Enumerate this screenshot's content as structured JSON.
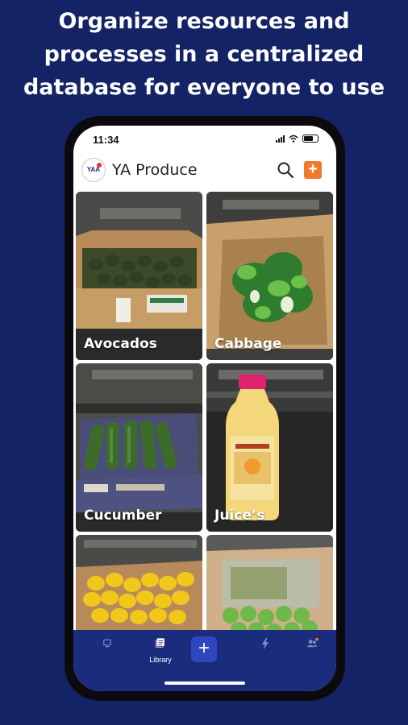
{
  "headline": {
    "line1": "Organize resources and",
    "line2": "processes in a centralized",
    "line3": "database for everyone to use"
  },
  "status_bar": {
    "time": "11:34"
  },
  "app_bar": {
    "title": "YA Produce",
    "logo_text": "YAA",
    "icons": {
      "search": "search-icon",
      "add": "add-square-icon"
    },
    "accent_color": "#f2782b"
  },
  "library_items": [
    {
      "label": "Avocados"
    },
    {
      "label": "Cabbage"
    },
    {
      "label": "Cucumber"
    },
    {
      "label": "Juice’s"
    },
    {
      "label": ""
    },
    {
      "label": ""
    }
  ],
  "tab_bar": {
    "tabs": [
      {
        "icon": "screen-icon",
        "label": ""
      },
      {
        "icon": "library-icon",
        "label": "Library"
      },
      {
        "icon": "plus-icon",
        "label": ""
      },
      {
        "icon": "lightning-icon",
        "label": ""
      },
      {
        "icon": "people-icon",
        "label": ""
      }
    ],
    "background": "#1b2c7c",
    "active_color": "#ffffff"
  },
  "colors": {
    "page_background": "#142366",
    "notification_dot": "#f2782b"
  }
}
